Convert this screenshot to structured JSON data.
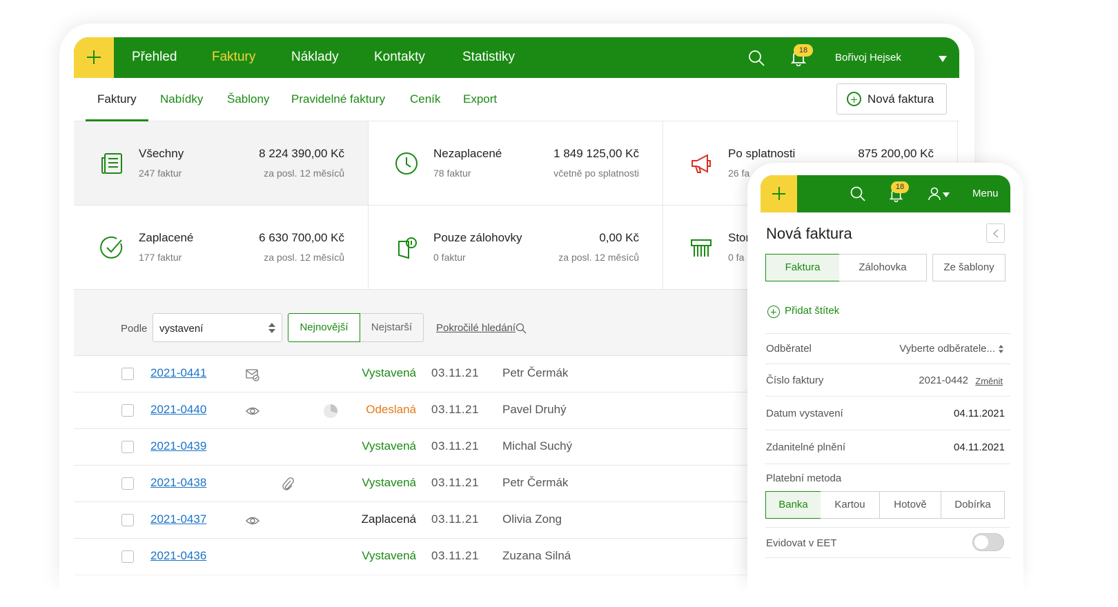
{
  "colors": {
    "brand_green": "#1b8a14",
    "accent_yellow": "#f7d33a",
    "link_blue": "#1a73c8",
    "status_orange": "#e57a17"
  },
  "topnav": {
    "items": [
      "Přehled",
      "Faktury",
      "Náklady",
      "Kontakty",
      "Statistiky"
    ],
    "active": "Faktury",
    "notifications": "18",
    "user": "Bořivoj Hejsek"
  },
  "subnav": {
    "items": [
      "Faktury",
      "Nabídky",
      "Šablony",
      "Pravidelné faktury",
      "Ceník",
      "Export"
    ],
    "active": "Faktury",
    "new_invoice": "Nová faktura"
  },
  "stats": [
    {
      "icon": "document-list-icon",
      "title": "Všechny",
      "count": "247 faktur",
      "amount": "8 224 390,00 Kč",
      "note": "za posl. 12 měsíců"
    },
    {
      "icon": "clock-icon",
      "title": "Nezaplacené",
      "count": "78 faktur",
      "amount": "1 849 125,00 Kč",
      "note": "včetně po splatnosti"
    },
    {
      "icon": "megaphone-icon",
      "title": "Po splatnosti",
      "count": "26 fa",
      "amount": "875 200,00 Kč",
      "note": ""
    },
    {
      "icon": "check-circle-icon",
      "title": "Zaplacené",
      "count": "177 faktur",
      "amount": "6 630 700,00 Kč",
      "note": "za posl. 12 měsíců"
    },
    {
      "icon": "deposit-icon",
      "title": "Pouze zálohovky",
      "count": "0 faktur",
      "amount": "0,00 Kč",
      "note": "za posl. 12 měsíců"
    },
    {
      "icon": "shredder-icon",
      "title": "Stor",
      "count": "0 fa",
      "amount": "",
      "note": ""
    }
  ],
  "filter": {
    "label": "Podle",
    "select_value": "vystavení",
    "newest": "Nejnovější",
    "oldest": "Nejstarší",
    "advanced": "Pokročilé hledání"
  },
  "invoices": [
    {
      "number": "2021-0441",
      "status": "Vystavená",
      "date": "03.11.21",
      "client": "Petr Čermák"
    },
    {
      "number": "2021-0440",
      "status": "Odeslaná",
      "date": "03.11.21",
      "client": "Pavel Druhý"
    },
    {
      "number": "2021-0439",
      "status": "Vystavená",
      "date": "03.11.21",
      "client": "Michal Suchý"
    },
    {
      "number": "2021-0438",
      "status": "Vystavená",
      "date": "03.11.21",
      "client": "Petr Čermák"
    },
    {
      "number": "2021-0437",
      "status": "Zaplacená",
      "date": "03.11.21",
      "client": "Olivia Zong"
    },
    {
      "number": "2021-0436",
      "status": "Vystavená",
      "date": "03.11.21",
      "client": "Zuzana Silná"
    }
  ],
  "phone": {
    "notifications": "18",
    "menu": "Menu",
    "title": "Nová faktura",
    "tabs": [
      "Faktura",
      "Zálohovka",
      "Ze šablony"
    ],
    "add_tag": "Přidat štítek",
    "customer_label": "Odběratel",
    "customer_value": "Vyberte odběratele...",
    "invoice_no_label": "Číslo faktury",
    "invoice_no_value": "2021-0442",
    "change": "Změnit",
    "issue_date_label": "Datum vystavení",
    "issue_date_value": "04.11.2021",
    "taxable_label": "Zdanitelné plnění",
    "taxable_value": "04.11.2021",
    "payment_label": "Platební metoda",
    "payment_methods": [
      "Banka",
      "Kartou",
      "Hotově",
      "Dobírka"
    ],
    "eet_label": "Evidovat v EET"
  }
}
